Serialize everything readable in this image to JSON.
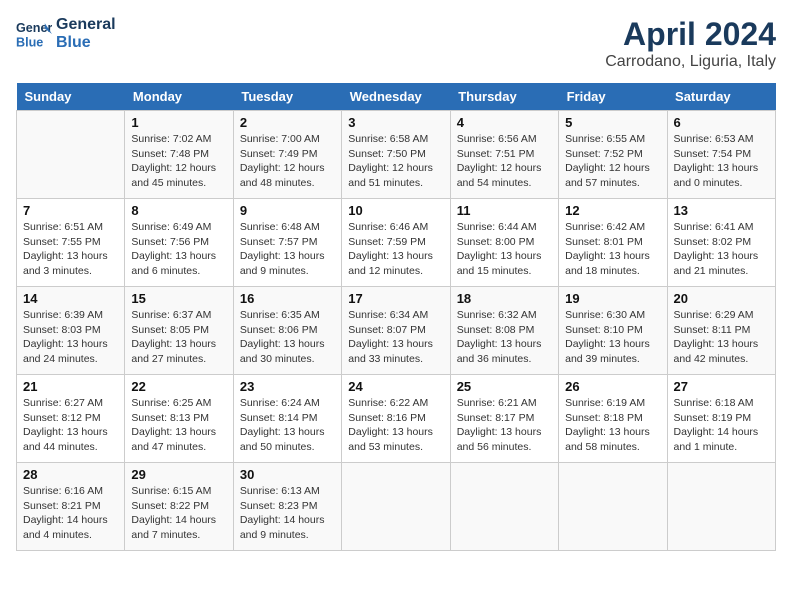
{
  "header": {
    "logo_line1": "General",
    "logo_line2": "Blue",
    "title": "April 2024",
    "location": "Carrodano, Liguria, Italy"
  },
  "calendar": {
    "days_of_week": [
      "Sunday",
      "Monday",
      "Tuesday",
      "Wednesday",
      "Thursday",
      "Friday",
      "Saturday"
    ],
    "weeks": [
      [
        {
          "day": "",
          "content": ""
        },
        {
          "day": "1",
          "content": "Sunrise: 7:02 AM\nSunset: 7:48 PM\nDaylight: 12 hours\nand 45 minutes."
        },
        {
          "day": "2",
          "content": "Sunrise: 7:00 AM\nSunset: 7:49 PM\nDaylight: 12 hours\nand 48 minutes."
        },
        {
          "day": "3",
          "content": "Sunrise: 6:58 AM\nSunset: 7:50 PM\nDaylight: 12 hours\nand 51 minutes."
        },
        {
          "day": "4",
          "content": "Sunrise: 6:56 AM\nSunset: 7:51 PM\nDaylight: 12 hours\nand 54 minutes."
        },
        {
          "day": "5",
          "content": "Sunrise: 6:55 AM\nSunset: 7:52 PM\nDaylight: 12 hours\nand 57 minutes."
        },
        {
          "day": "6",
          "content": "Sunrise: 6:53 AM\nSunset: 7:54 PM\nDaylight: 13 hours\nand 0 minutes."
        }
      ],
      [
        {
          "day": "7",
          "content": "Sunrise: 6:51 AM\nSunset: 7:55 PM\nDaylight: 13 hours\nand 3 minutes."
        },
        {
          "day": "8",
          "content": "Sunrise: 6:49 AM\nSunset: 7:56 PM\nDaylight: 13 hours\nand 6 minutes."
        },
        {
          "day": "9",
          "content": "Sunrise: 6:48 AM\nSunset: 7:57 PM\nDaylight: 13 hours\nand 9 minutes."
        },
        {
          "day": "10",
          "content": "Sunrise: 6:46 AM\nSunset: 7:59 PM\nDaylight: 13 hours\nand 12 minutes."
        },
        {
          "day": "11",
          "content": "Sunrise: 6:44 AM\nSunset: 8:00 PM\nDaylight: 13 hours\nand 15 minutes."
        },
        {
          "day": "12",
          "content": "Sunrise: 6:42 AM\nSunset: 8:01 PM\nDaylight: 13 hours\nand 18 minutes."
        },
        {
          "day": "13",
          "content": "Sunrise: 6:41 AM\nSunset: 8:02 PM\nDaylight: 13 hours\nand 21 minutes."
        }
      ],
      [
        {
          "day": "14",
          "content": "Sunrise: 6:39 AM\nSunset: 8:03 PM\nDaylight: 13 hours\nand 24 minutes."
        },
        {
          "day": "15",
          "content": "Sunrise: 6:37 AM\nSunset: 8:05 PM\nDaylight: 13 hours\nand 27 minutes."
        },
        {
          "day": "16",
          "content": "Sunrise: 6:35 AM\nSunset: 8:06 PM\nDaylight: 13 hours\nand 30 minutes."
        },
        {
          "day": "17",
          "content": "Sunrise: 6:34 AM\nSunset: 8:07 PM\nDaylight: 13 hours\nand 33 minutes."
        },
        {
          "day": "18",
          "content": "Sunrise: 6:32 AM\nSunset: 8:08 PM\nDaylight: 13 hours\nand 36 minutes."
        },
        {
          "day": "19",
          "content": "Sunrise: 6:30 AM\nSunset: 8:10 PM\nDaylight: 13 hours\nand 39 minutes."
        },
        {
          "day": "20",
          "content": "Sunrise: 6:29 AM\nSunset: 8:11 PM\nDaylight: 13 hours\nand 42 minutes."
        }
      ],
      [
        {
          "day": "21",
          "content": "Sunrise: 6:27 AM\nSunset: 8:12 PM\nDaylight: 13 hours\nand 44 minutes."
        },
        {
          "day": "22",
          "content": "Sunrise: 6:25 AM\nSunset: 8:13 PM\nDaylight: 13 hours\nand 47 minutes."
        },
        {
          "day": "23",
          "content": "Sunrise: 6:24 AM\nSunset: 8:14 PM\nDaylight: 13 hours\nand 50 minutes."
        },
        {
          "day": "24",
          "content": "Sunrise: 6:22 AM\nSunset: 8:16 PM\nDaylight: 13 hours\nand 53 minutes."
        },
        {
          "day": "25",
          "content": "Sunrise: 6:21 AM\nSunset: 8:17 PM\nDaylight: 13 hours\nand 56 minutes."
        },
        {
          "day": "26",
          "content": "Sunrise: 6:19 AM\nSunset: 8:18 PM\nDaylight: 13 hours\nand 58 minutes."
        },
        {
          "day": "27",
          "content": "Sunrise: 6:18 AM\nSunset: 8:19 PM\nDaylight: 14 hours\nand 1 minute."
        }
      ],
      [
        {
          "day": "28",
          "content": "Sunrise: 6:16 AM\nSunset: 8:21 PM\nDaylight: 14 hours\nand 4 minutes."
        },
        {
          "day": "29",
          "content": "Sunrise: 6:15 AM\nSunset: 8:22 PM\nDaylight: 14 hours\nand 7 minutes."
        },
        {
          "day": "30",
          "content": "Sunrise: 6:13 AM\nSunset: 8:23 PM\nDaylight: 14 hours\nand 9 minutes."
        },
        {
          "day": "",
          "content": ""
        },
        {
          "day": "",
          "content": ""
        },
        {
          "day": "",
          "content": ""
        },
        {
          "day": "",
          "content": ""
        }
      ]
    ]
  }
}
